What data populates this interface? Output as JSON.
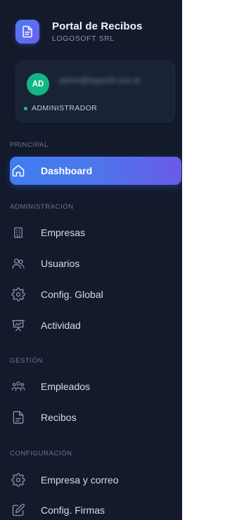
{
  "brand": {
    "title": "Portal de Recibos",
    "subtitle": "LOGOSOFT SRL",
    "icon": "document-icon",
    "accent_start": "#4f7cf5",
    "accent_end": "#6a5ef0"
  },
  "user": {
    "initials": "AD",
    "email": "admin@logosoft.com.ar",
    "role": "ADMINISTRADOR",
    "avatar_color": "#12b783",
    "status_color": "#1fc48a"
  },
  "sections": {
    "principal": "PRINCIPAL",
    "administracion": "ADMINISTRACIÓN",
    "gestion": "GESTIÓN",
    "configuracion": "CONFIGURACIÓN"
  },
  "nav": {
    "dashboard": {
      "label": "Dashboard",
      "icon": "home-icon",
      "active": true
    },
    "empresas": {
      "label": "Empresas",
      "icon": "building-icon"
    },
    "usuarios": {
      "label": "Usuarios",
      "icon": "users-icon"
    },
    "config_global": {
      "label": "Config. Global",
      "icon": "gear-icon"
    },
    "actividad": {
      "label": "Actividad",
      "icon": "presentation-icon"
    },
    "empleados": {
      "label": "Empleados",
      "icon": "team-icon"
    },
    "recibos": {
      "label": "Recibos",
      "icon": "file-icon"
    },
    "empresa_correo": {
      "label": "Empresa y correo",
      "icon": "gear-icon"
    },
    "config_firmas": {
      "label": "Config. Firmas",
      "icon": "edit-icon"
    }
  },
  "colors": {
    "sidebar_bg": "#121a2c",
    "active_start": "#3f7cf0",
    "active_end": "#6a5ae8"
  }
}
